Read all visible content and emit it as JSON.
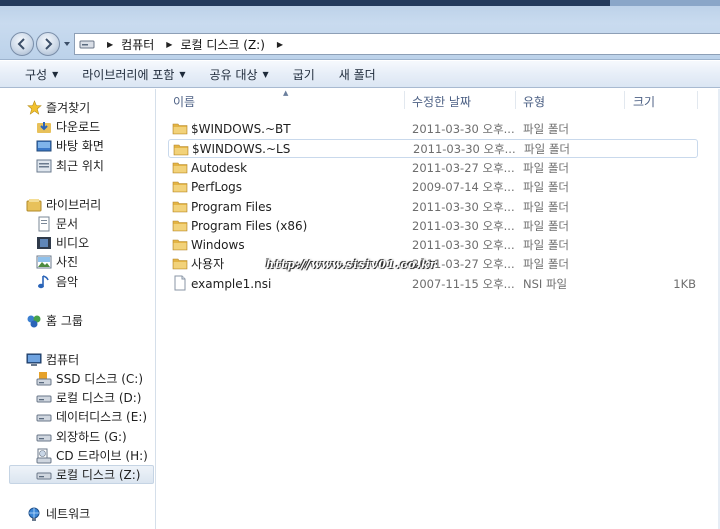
{
  "address": {
    "crumbs": [
      "컴퓨터",
      "로컬 디스크 (Z:)"
    ]
  },
  "toolbar": {
    "organize": "구성",
    "include_library": "라이브러리에 포함",
    "share_with": "공유 대상",
    "burn": "굽기",
    "new_folder": "새 폴더"
  },
  "nav": {
    "favorites": "즐겨찾기",
    "downloads": "다운로드",
    "desktop": "바탕 화면",
    "recent": "최근 위치",
    "libraries": "라이브러리",
    "documents": "문서",
    "videos": "비디오",
    "pictures": "사진",
    "music": "음악",
    "homegroup": "홈 그룹",
    "computer": "컴퓨터",
    "drive_c": "SSD 디스크 (C:)",
    "drive_d": "로컬 디스크 (D:)",
    "drive_e": "데이터디스크 (E:)",
    "drive_g": "외장하드 (G:)",
    "drive_h": "CD 드라이브 (H:)",
    "drive_z": "로컬 디스크 (Z:)",
    "network": "네트워크"
  },
  "columns": {
    "name": "이름",
    "modified": "수정한 날짜",
    "type": "유형",
    "size": "크기"
  },
  "files": [
    {
      "name": "$WINDOWS.~BT",
      "date": "2011-03-30 오후...",
      "type": "파일 폴더",
      "size": "",
      "icon": "folder-icon"
    },
    {
      "name": "$WINDOWS.~LS",
      "date": "2011-03-30 오후...",
      "type": "파일 폴더",
      "size": "",
      "icon": "folder-icon"
    },
    {
      "name": "Autodesk",
      "date": "2011-03-27 오후...",
      "type": "파일 폴더",
      "size": "",
      "icon": "folder-icon"
    },
    {
      "name": "PerfLogs",
      "date": "2009-07-14 오후...",
      "type": "파일 폴더",
      "size": "",
      "icon": "folder-icon"
    },
    {
      "name": "Program Files",
      "date": "2011-03-30 오후...",
      "type": "파일 폴더",
      "size": "",
      "icon": "folder-icon"
    },
    {
      "name": "Program Files (x86)",
      "date": "2011-03-30 오후...",
      "type": "파일 폴더",
      "size": "",
      "icon": "folder-icon"
    },
    {
      "name": "Windows",
      "date": "2011-03-30 오후...",
      "type": "파일 폴더",
      "size": "",
      "icon": "folder-icon"
    },
    {
      "name": "사용자",
      "date": "2011-03-27 오후...",
      "type": "파일 폴더",
      "size": "",
      "icon": "folder-icon"
    },
    {
      "name": "example1.nsi",
      "date": "2007-11-15 오후...",
      "type": "NSI 파일",
      "size": "1KB",
      "icon": "file-icon"
    }
  ],
  "watermark": "http://www.sisiv01.co.kr",
  "colors": {
    "accent": "#3a6ea5",
    "folder": "#e8c15a",
    "header_text": "#4d6185"
  }
}
